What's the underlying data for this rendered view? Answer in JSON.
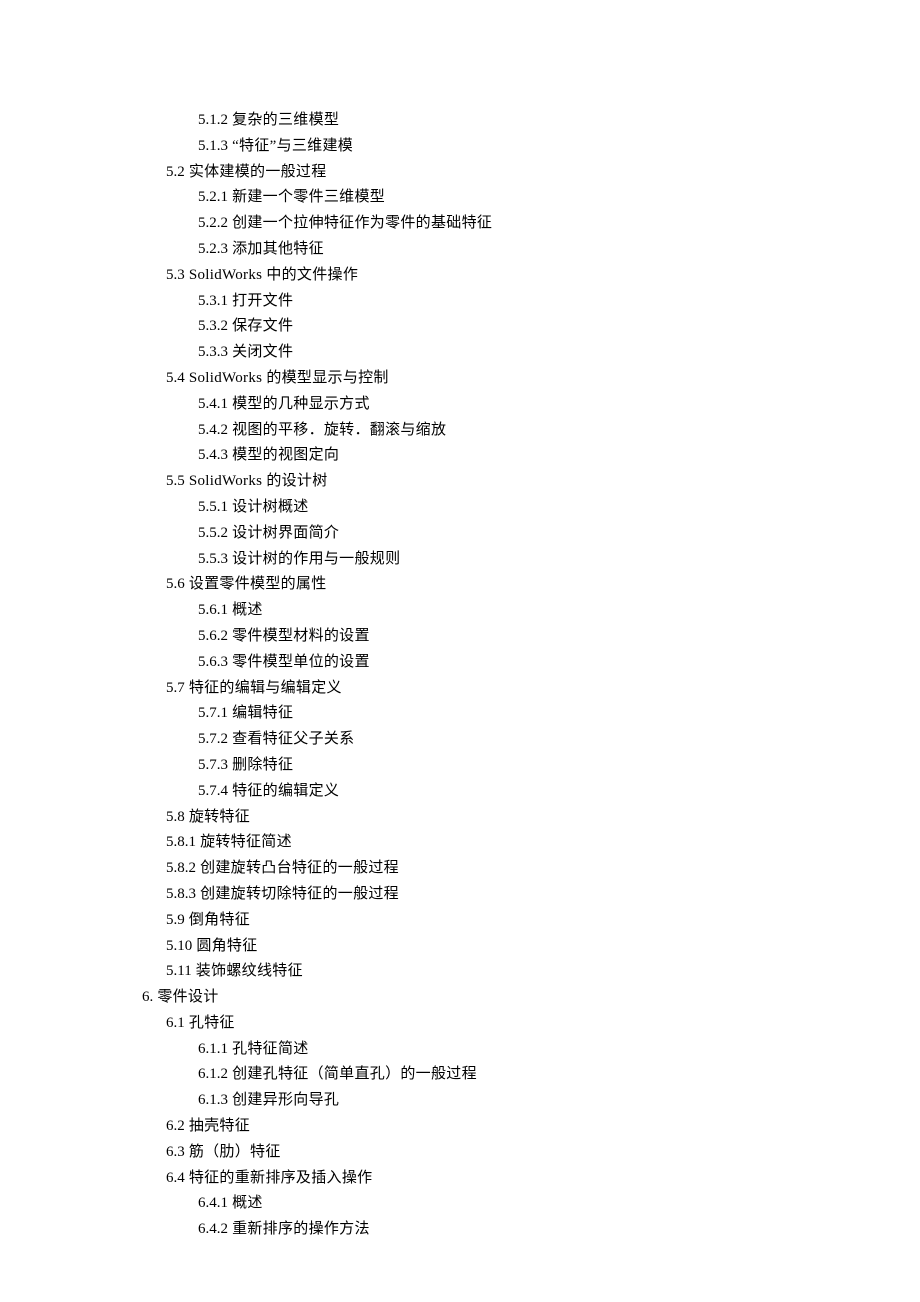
{
  "lines": [
    {
      "level": "l3",
      "num": "5.1.2",
      "text": "复杂的三维模型"
    },
    {
      "level": "l3",
      "num": "5.1.3",
      "text": "“特征”与三维建模"
    },
    {
      "level": "l2",
      "num": "5.2",
      "text": "实体建模的一般过程"
    },
    {
      "level": "l3",
      "num": "5.2.1",
      "text": "新建一个零件三维模型"
    },
    {
      "level": "l3",
      "num": "5.2.2",
      "text": "创建一个拉伸特征作为零件的基础特征"
    },
    {
      "level": "l3",
      "num": "5.2.3",
      "text": "添加其他特征"
    },
    {
      "level": "l2",
      "num": "5.3",
      "text": "SolidWorks 中的文件操作",
      "numInText": true
    },
    {
      "level": "l3",
      "num": "5.3.1",
      "text": "打开文件"
    },
    {
      "level": "l3",
      "num": "5.3.2",
      "text": "保存文件"
    },
    {
      "level": "l3",
      "num": "5.3.3",
      "text": "关闭文件"
    },
    {
      "level": "l2",
      "num": "5.4",
      "text": "SolidWorks 的模型显示与控制",
      "numInText": true
    },
    {
      "level": "l3",
      "num": "5.4.1",
      "text": "模型的几种显示方式"
    },
    {
      "level": "l3",
      "num": "5.4.2",
      "text": "视图的平移．旋转．翻滚与缩放"
    },
    {
      "level": "l3",
      "num": "5.4.3",
      "text": "模型的视图定向"
    },
    {
      "level": "l2",
      "num": "5.5",
      "text": "SolidWorks 的设计树",
      "numInText": true
    },
    {
      "level": "l3",
      "num": "5.5.1",
      "text": "设计树概述"
    },
    {
      "level": "l3",
      "num": "5.5.2",
      "text": "设计树界面简介"
    },
    {
      "level": "l3",
      "num": "5.5.3",
      "text": "设计树的作用与一般规则"
    },
    {
      "level": "l2",
      "num": "5.6",
      "text": "设置零件模型的属性"
    },
    {
      "level": "l3",
      "num": "5.6.1",
      "text": "概述"
    },
    {
      "level": "l3",
      "num": "5.6.2",
      "text": "零件模型材料的设置"
    },
    {
      "level": "l3",
      "num": "5.6.3",
      "text": "零件模型单位的设置"
    },
    {
      "level": "l2",
      "num": "5.7",
      "text": "特征的编辑与编辑定义"
    },
    {
      "level": "l3",
      "num": "5.7.1",
      "text": "编辑特征"
    },
    {
      "level": "l3",
      "num": "5.7.2",
      "text": "查看特征父子关系"
    },
    {
      "level": "l3",
      "num": "5.7.3",
      "text": "删除特征"
    },
    {
      "level": "l3",
      "num": "5.7.4",
      "text": "特征的编辑定义"
    },
    {
      "level": "l2",
      "num": "5.8",
      "text": "旋转特征"
    },
    {
      "level": "l3b",
      "num": "5.8.1",
      "text": "旋转特征简述"
    },
    {
      "level": "l3b",
      "num": "5.8.2",
      "text": "创建旋转凸台特征的一般过程"
    },
    {
      "level": "l3b",
      "num": "5.8.3",
      "text": "创建旋转切除特征的一般过程"
    },
    {
      "level": "l2",
      "num": "5.9",
      "text": "倒角特征"
    },
    {
      "level": "l2",
      "num": "5.10",
      "text": "圆角特征"
    },
    {
      "level": "l2",
      "num": "5.11",
      "text": "装饰螺纹线特征"
    },
    {
      "level": "l1",
      "num": "6.",
      "text": "零件设计"
    },
    {
      "level": "l2",
      "num": "6.1",
      "text": "孔特征"
    },
    {
      "level": "l3",
      "num": "6.1.1",
      "text": "孔特征简述"
    },
    {
      "level": "l3",
      "num": "6.1.2",
      "text": "创建孔特征（简单直孔）的一般过程"
    },
    {
      "level": "l3",
      "num": "6.1.3",
      "text": "创建异形向导孔"
    },
    {
      "level": "l2",
      "num": "6.2",
      "text": "抽壳特征"
    },
    {
      "level": "l2",
      "num": "6.3",
      "text": "筋（肋）特征"
    },
    {
      "level": "l2",
      "num": "6.4",
      "text": "特征的重新排序及插入操作"
    },
    {
      "level": "l3",
      "num": "6.4.1",
      "text": "概述"
    },
    {
      "level": "l3",
      "num": "6.4.2",
      "text": "重新排序的操作方法"
    }
  ]
}
